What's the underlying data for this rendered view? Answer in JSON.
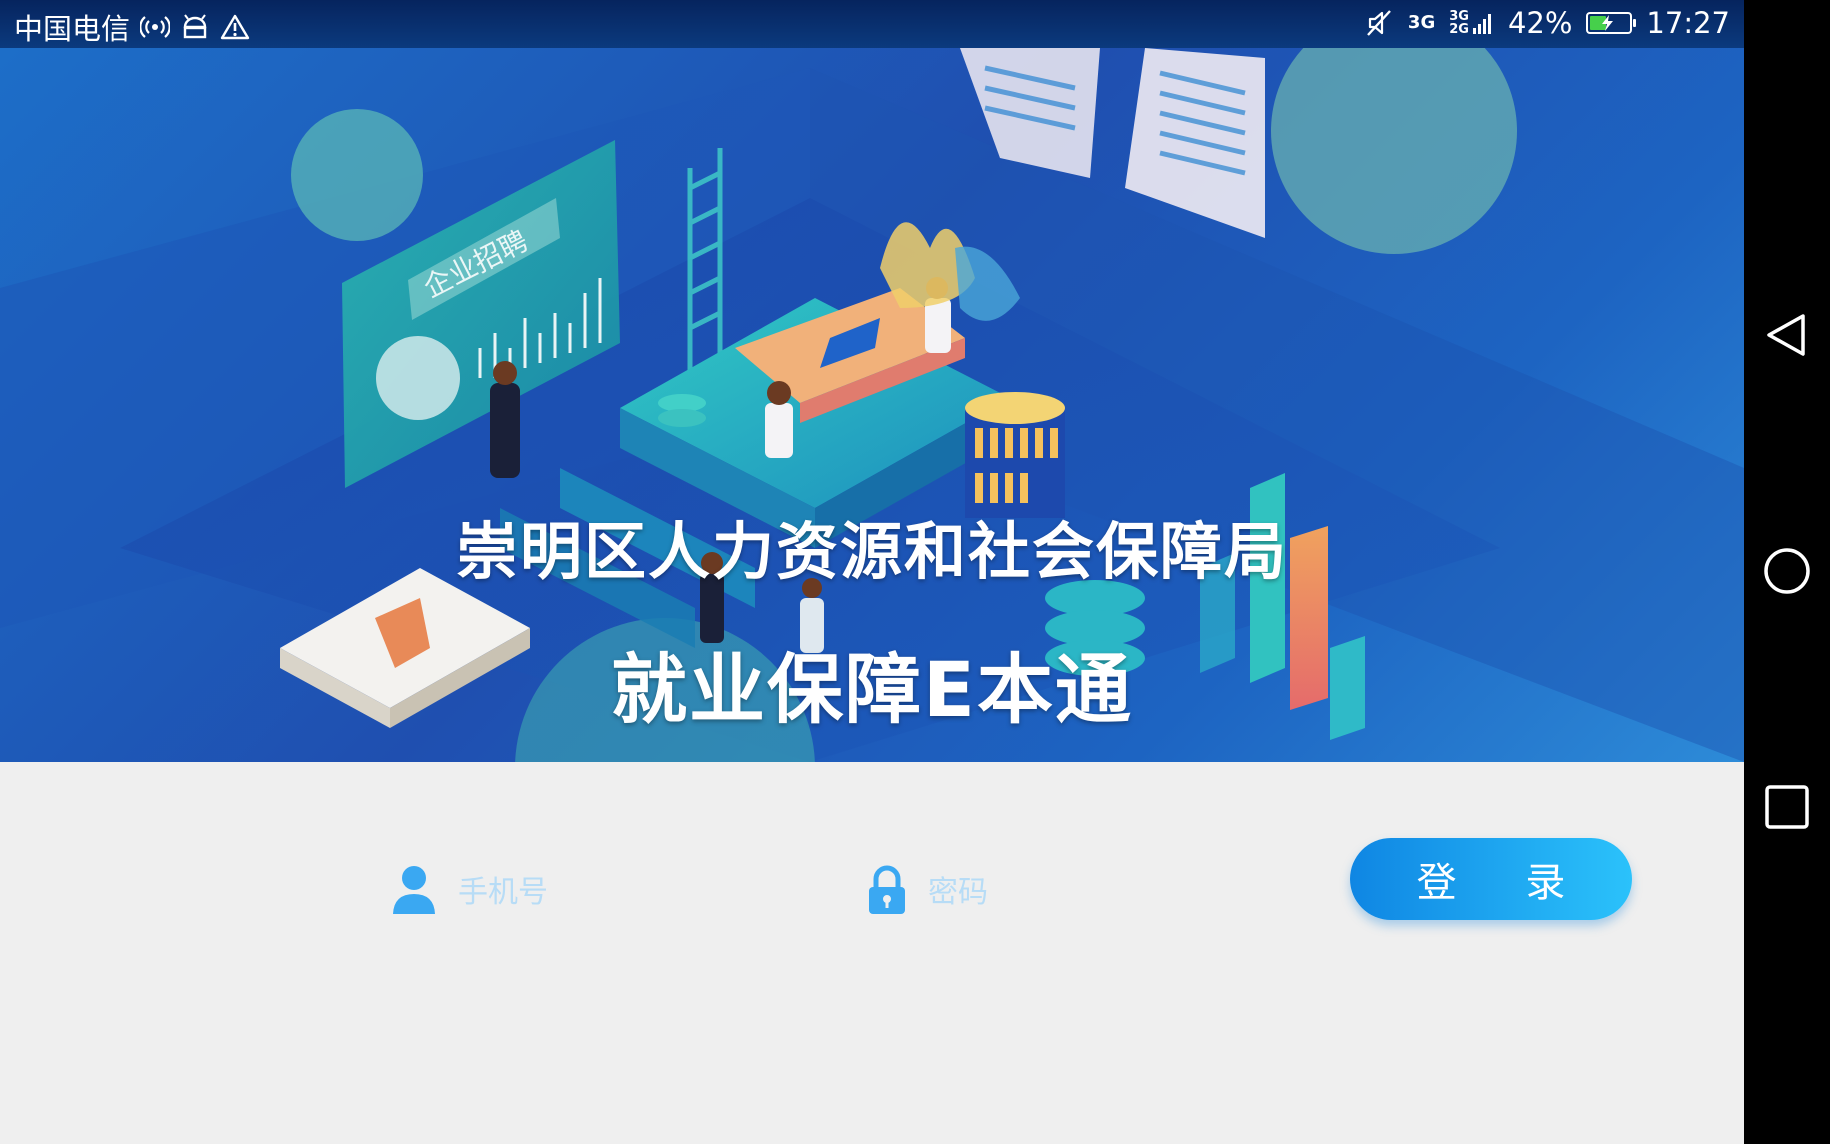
{
  "status_bar": {
    "carrier": "中国电信",
    "network_primary": "3G",
    "network_secondary_top": "3G",
    "network_secondary_bottom": "2G",
    "battery_percent_text": "42%",
    "battery_level": 0.42,
    "time": "17:27",
    "icons": [
      "hotspot-icon",
      "android-icon",
      "warning-icon",
      "mute-icon",
      "signal-icon",
      "battery-icon"
    ]
  },
  "banner": {
    "title": "崇明区人力资源和社会保障局",
    "subtitle": "就业保障E本通",
    "illustration_sign": "企业招聘"
  },
  "login": {
    "phone_placeholder": "手机号",
    "password_placeholder": "密码",
    "submit_label": "登 录"
  },
  "nav": {
    "icons": [
      "back-icon",
      "home-icon",
      "recents-icon"
    ]
  },
  "colors": {
    "status_bar": "#0b3a7e",
    "banner_blue": "#1f4fb0",
    "accent": "#2bc2fb",
    "button_start": "#0f86e3",
    "icon_blue": "#3aa8f2",
    "placeholder": "#b7dcf6",
    "page_background": "#efefef"
  }
}
